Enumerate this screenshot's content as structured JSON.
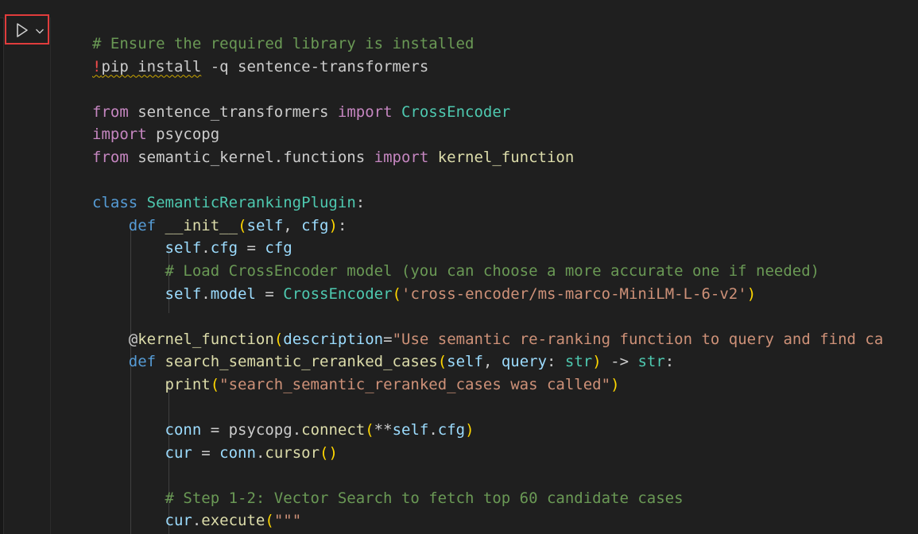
{
  "toolbar": {
    "run_icon": "play-icon",
    "run_menu_icon": "chevron-down-icon",
    "highlight_color": "#e03c3c"
  },
  "editor": {
    "language": "python",
    "lines": [
      [
        {
          "t": "# Ensure the required library is installed",
          "c": "comment"
        }
      ],
      [
        {
          "t": "!",
          "c": "excl",
          "sq": true
        },
        {
          "t": "pip install",
          "c": "plain",
          "sq": true
        },
        {
          "t": " -q sentence-transformers",
          "c": "plain"
        }
      ],
      [],
      [
        {
          "t": "from",
          "c": "keyword"
        },
        {
          "t": " sentence_transformers ",
          "c": "plain"
        },
        {
          "t": "import",
          "c": "keyword"
        },
        {
          "t": " ",
          "c": "plain"
        },
        {
          "t": "CrossEncoder",
          "c": "class"
        }
      ],
      [
        {
          "t": "import",
          "c": "keyword"
        },
        {
          "t": " psycopg",
          "c": "plain"
        }
      ],
      [
        {
          "t": "from",
          "c": "keyword"
        },
        {
          "t": " semantic_kernel.functions ",
          "c": "plain"
        },
        {
          "t": "import",
          "c": "keyword"
        },
        {
          "t": " ",
          "c": "plain"
        },
        {
          "t": "kernel_function",
          "c": "func"
        }
      ],
      [],
      [
        {
          "t": "class",
          "c": "blue"
        },
        {
          "t": " ",
          "c": "plain"
        },
        {
          "t": "SemanticRerankingPlugin",
          "c": "class"
        },
        {
          "t": ":",
          "c": "plain"
        }
      ],
      [
        {
          "t": "    ",
          "c": "plain"
        },
        {
          "t": "def",
          "c": "blue"
        },
        {
          "t": " ",
          "c": "plain"
        },
        {
          "t": "__init__",
          "c": "func"
        },
        {
          "t": "(",
          "c": "paren"
        },
        {
          "t": "self",
          "c": "param"
        },
        {
          "t": ", ",
          "c": "plain"
        },
        {
          "t": "cfg",
          "c": "param"
        },
        {
          "t": ")",
          "c": "paren"
        },
        {
          "t": ":",
          "c": "plain"
        }
      ],
      [
        {
          "t": "        ",
          "c": "plain"
        },
        {
          "t": "self",
          "c": "param"
        },
        {
          "t": ".",
          "c": "plain"
        },
        {
          "t": "cfg",
          "c": "param"
        },
        {
          "t": " = ",
          "c": "plain"
        },
        {
          "t": "cfg",
          "c": "param"
        }
      ],
      [
        {
          "t": "        ",
          "c": "plain"
        },
        {
          "t": "# Load CrossEncoder model (you can choose a more accurate one if needed)",
          "c": "comment"
        }
      ],
      [
        {
          "t": "        ",
          "c": "plain"
        },
        {
          "t": "self",
          "c": "param"
        },
        {
          "t": ".",
          "c": "plain"
        },
        {
          "t": "model",
          "c": "param"
        },
        {
          "t": " = ",
          "c": "plain"
        },
        {
          "t": "CrossEncoder",
          "c": "class"
        },
        {
          "t": "(",
          "c": "paren"
        },
        {
          "t": "'cross-encoder/ms-marco-MiniLM-L-6-v2'",
          "c": "string"
        },
        {
          "t": ")",
          "c": "paren"
        }
      ],
      [],
      [
        {
          "t": "    ",
          "c": "plain"
        },
        {
          "t": "@",
          "c": "plain"
        },
        {
          "t": "kernel_function",
          "c": "func"
        },
        {
          "t": "(",
          "c": "paren"
        },
        {
          "t": "description",
          "c": "param"
        },
        {
          "t": "=",
          "c": "plain"
        },
        {
          "t": "\"Use semantic re-ranking function to query and find ca",
          "c": "string"
        }
      ],
      [
        {
          "t": "    ",
          "c": "plain"
        },
        {
          "t": "def",
          "c": "blue"
        },
        {
          "t": " ",
          "c": "plain"
        },
        {
          "t": "search_semantic_reranked_cases",
          "c": "func"
        },
        {
          "t": "(",
          "c": "paren"
        },
        {
          "t": "self",
          "c": "param"
        },
        {
          "t": ", ",
          "c": "plain"
        },
        {
          "t": "query",
          "c": "param"
        },
        {
          "t": ": ",
          "c": "plain"
        },
        {
          "t": "str",
          "c": "class"
        },
        {
          "t": ")",
          "c": "paren"
        },
        {
          "t": " -> ",
          "c": "plain"
        },
        {
          "t": "str",
          "c": "class"
        },
        {
          "t": ":",
          "c": "plain"
        }
      ],
      [
        {
          "t": "        ",
          "c": "plain"
        },
        {
          "t": "print",
          "c": "func"
        },
        {
          "t": "(",
          "c": "paren"
        },
        {
          "t": "\"search_semantic_reranked_cases was called\"",
          "c": "string"
        },
        {
          "t": ")",
          "c": "paren"
        }
      ],
      [],
      [
        {
          "t": "        ",
          "c": "plain"
        },
        {
          "t": "conn",
          "c": "param"
        },
        {
          "t": " = ",
          "c": "plain"
        },
        {
          "t": "psycopg",
          "c": "plain"
        },
        {
          "t": ".",
          "c": "plain"
        },
        {
          "t": "connect",
          "c": "func"
        },
        {
          "t": "(",
          "c": "paren"
        },
        {
          "t": "**",
          "c": "plain"
        },
        {
          "t": "self",
          "c": "param"
        },
        {
          "t": ".",
          "c": "plain"
        },
        {
          "t": "cfg",
          "c": "param"
        },
        {
          "t": ")",
          "c": "paren"
        }
      ],
      [
        {
          "t": "        ",
          "c": "plain"
        },
        {
          "t": "cur",
          "c": "param"
        },
        {
          "t": " = ",
          "c": "plain"
        },
        {
          "t": "conn",
          "c": "param"
        },
        {
          "t": ".",
          "c": "plain"
        },
        {
          "t": "cursor",
          "c": "func"
        },
        {
          "t": "(",
          "c": "paren"
        },
        {
          "t": ")",
          "c": "paren"
        }
      ],
      [],
      [
        {
          "t": "        ",
          "c": "plain"
        },
        {
          "t": "# Step 1-2: Vector Search to fetch top 60 candidate cases",
          "c": "comment"
        }
      ],
      [
        {
          "t": "        ",
          "c": "plain"
        },
        {
          "t": "cur",
          "c": "param"
        },
        {
          "t": ".",
          "c": "plain"
        },
        {
          "t": "execute",
          "c": "func"
        },
        {
          "t": "(",
          "c": "paren"
        },
        {
          "t": "\"\"\"",
          "c": "string"
        }
      ]
    ]
  }
}
